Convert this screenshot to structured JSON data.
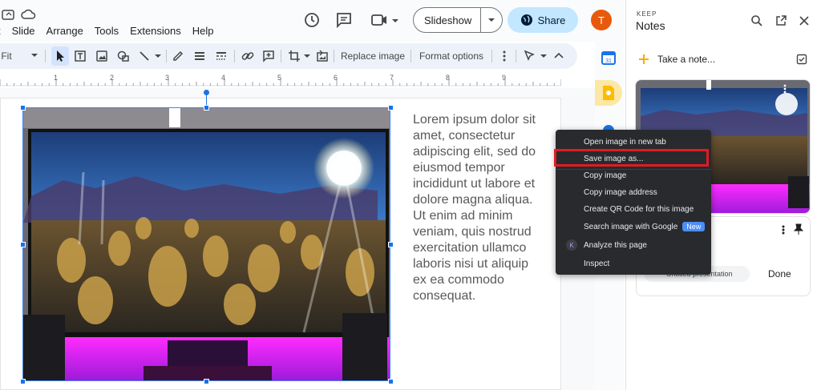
{
  "menu": [
    "Slide",
    "Arrange",
    "Tools",
    "Extensions",
    "Help"
  ],
  "toolbar": {
    "zoom_value": "Fit",
    "replace_image": "Replace image",
    "format_options": "Format options"
  },
  "header": {
    "slideshow_label": "Slideshow",
    "share_label": "Share",
    "avatar_initial": "T"
  },
  "ruler": [
    "1",
    "2",
    "3",
    "4",
    "5",
    "6",
    "7",
    "8",
    "9"
  ],
  "slide": {
    "body_text": "Lorem ipsum dolor sit amet, consectetur adipiscing elit, sed do eiusmod tempor incididunt ut labore et dolore magna aliqua. Ut enim ad minim veniam, quis nostrud exercitation ullamco laboris nisi ut aliquip ex ea commodo consequat."
  },
  "keep": {
    "brand": "KEEP",
    "title": "Notes",
    "take_note": "Take a note...",
    "chip_label": "Untitled presentation",
    "done_label": "Done"
  },
  "context_menu": {
    "items": [
      "Open image in new tab",
      "Save image as...",
      "Copy image",
      "Copy image address",
      "Create QR Code for this image",
      "Search image with Google",
      "Analyze this page",
      "Inspect"
    ],
    "new_badge": "New",
    "analyze_icon_letter": "K",
    "highlighted_index": 1
  },
  "colors": {
    "accent_blue": "#1a73e8",
    "share_bg": "#c2e7ff",
    "highlight_red": "#e01b24",
    "menu_bg": "#292a2d",
    "avatar_bg": "#e8590c"
  },
  "icons": [
    "history-icon",
    "comment-icon",
    "video-call-icon",
    "globe-icon",
    "search-icon",
    "open-in-new-icon",
    "close-icon",
    "plus-icon",
    "checkbox-icon",
    "pin-icon",
    "more-vert-icon"
  ]
}
